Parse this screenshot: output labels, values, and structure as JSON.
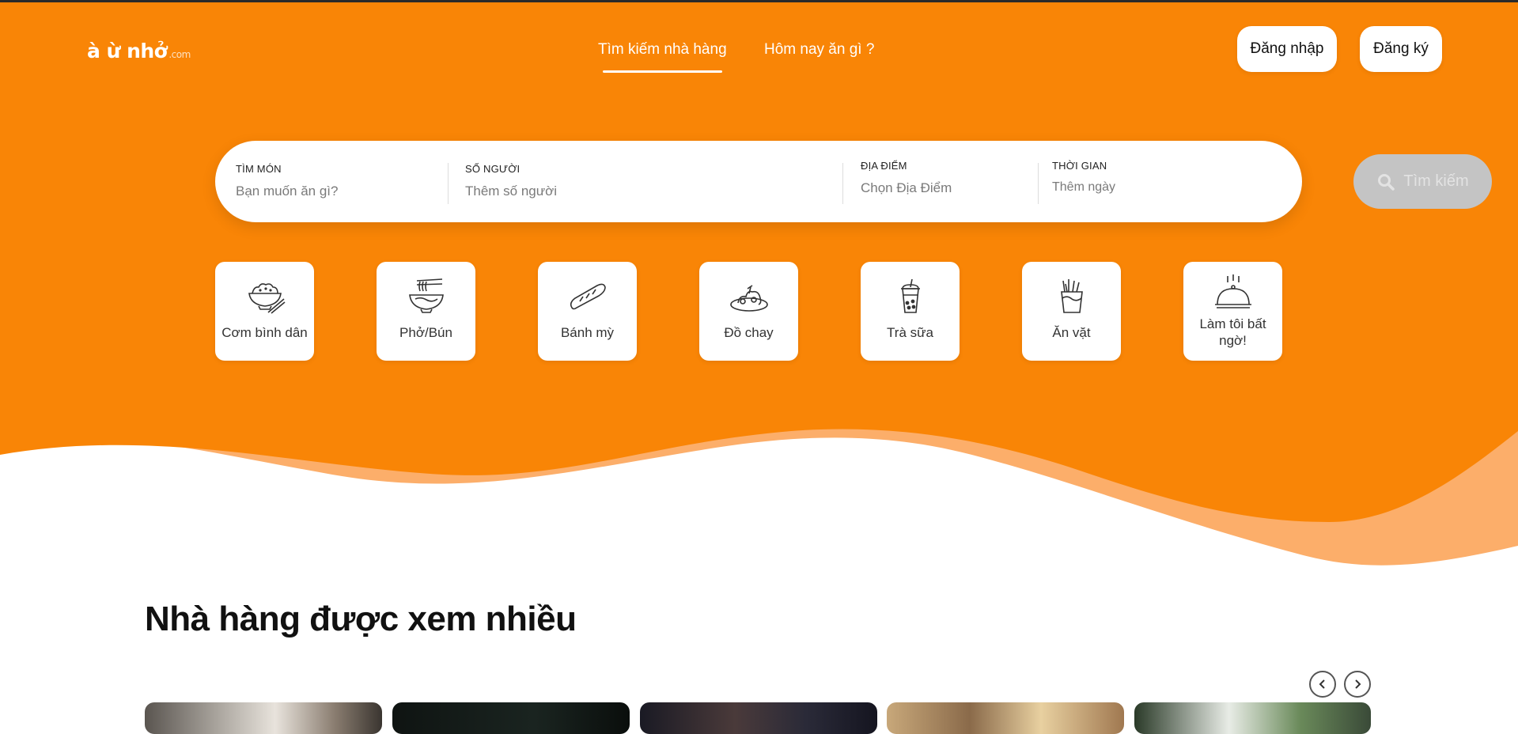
{
  "logo": {
    "text": "à ừ nhở",
    "suffix": ".com"
  },
  "nav": {
    "links": [
      {
        "label": "Tìm kiếm nhà hàng",
        "active": true
      },
      {
        "label": "Hôm nay ăn gì ?",
        "active": false
      }
    ]
  },
  "auth": {
    "login": "Đăng nhập",
    "signup": "Đăng ký"
  },
  "search": {
    "fields": [
      {
        "label": "Tìm món",
        "placeholder": "Bạn muốn ăn gì?"
      },
      {
        "label": "Số người",
        "placeholder": "Thêm số người"
      },
      {
        "label": "Địa điểm",
        "placeholder": "Chọn Địa Điểm"
      },
      {
        "label": "Thời gian",
        "placeholder": "Thêm ngày"
      }
    ],
    "button": "Tìm kiếm"
  },
  "categories": [
    {
      "label": "Cơm bình dân",
      "icon": "rice-bowl-icon"
    },
    {
      "label": "Phở/Bún",
      "icon": "noodle-bowl-icon"
    },
    {
      "label": "Bánh mỳ",
      "icon": "baguette-icon"
    },
    {
      "label": "Đồ chay",
      "icon": "vegetarian-plate-icon"
    },
    {
      "label": "Trà sữa",
      "icon": "bubble-tea-icon"
    },
    {
      "label": "Ăn vặt",
      "icon": "snack-fries-icon"
    },
    {
      "label": "Làm tôi bất ngờ!",
      "icon": "cloche-icon"
    }
  ],
  "section": {
    "title": "Nhà hàng được xem nhiều"
  },
  "colors": {
    "brand": "#f98506",
    "wave_light": "#fcae6a",
    "search_button": "#c4c4c4"
  }
}
